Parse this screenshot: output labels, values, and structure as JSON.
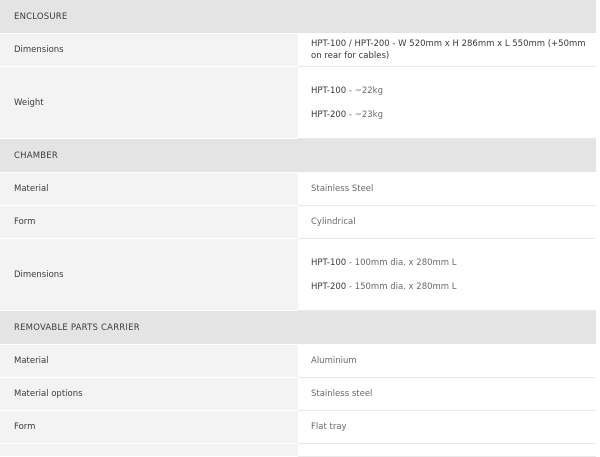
{
  "sections": [
    {
      "title": "ENCLOSURE",
      "rows": [
        {
          "label": "Dimensions",
          "value": "HPT-100 / HPT-200 - W 520mm x H 286mm x L 550mm (+50mm on rear for cables)"
        },
        {
          "label": "Weight",
          "lines": [
            {
              "model": "HPT-100",
              "rest": " - ~22kg"
            },
            {
              "model": "HPT-200",
              "rest": " - ~23kg"
            }
          ]
        }
      ]
    },
    {
      "title": "CHAMBER",
      "rows": [
        {
          "label": "Material",
          "value": "Stainless Steel"
        },
        {
          "label": "Form",
          "value": "Cylindrical"
        },
        {
          "label": "Dimensions",
          "lines": [
            {
              "model": "HPT-100",
              "rest": " - 100mm dia. x 280mm L"
            },
            {
              "model": "HPT-200",
              "rest": " - 150mm dia. x 280mm L"
            }
          ]
        }
      ]
    },
    {
      "title": "REMOVABLE PARTS CARRIER",
      "rows": [
        {
          "label": "Material",
          "value": "Aluminium"
        },
        {
          "label": "Material options",
          "value": "Stainless steel"
        },
        {
          "label": "Form",
          "value": "Flat tray"
        }
      ]
    }
  ]
}
